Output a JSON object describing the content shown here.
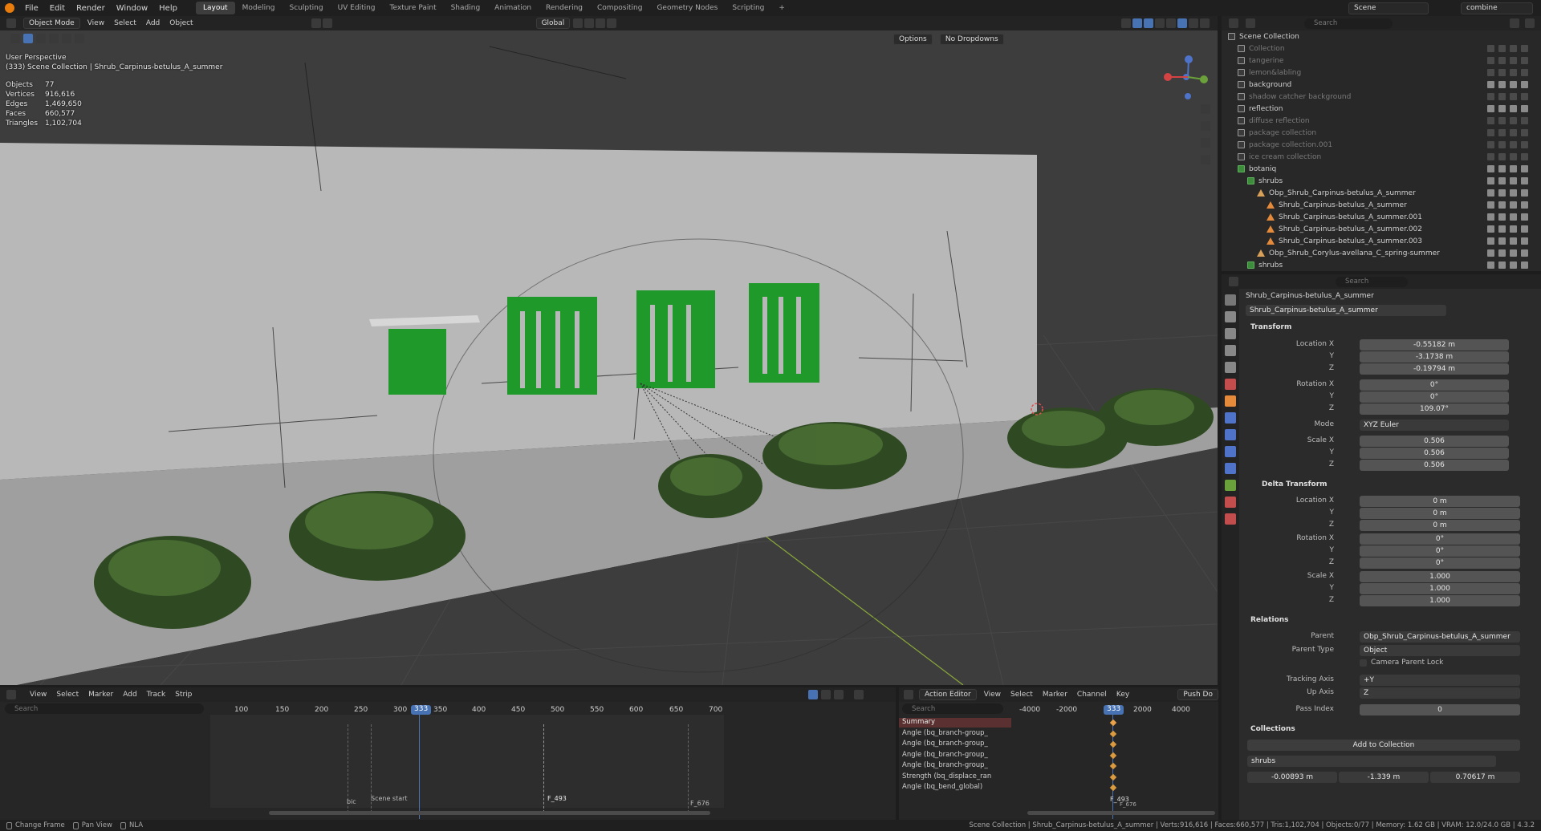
{
  "topbar": {
    "menus": [
      "File",
      "Edit",
      "Render",
      "Window",
      "Help"
    ],
    "workspaces": [
      "Layout",
      "Modeling",
      "Sculpting",
      "UV Editing",
      "Texture Paint",
      "Shading",
      "Animation",
      "Rendering",
      "Compositing",
      "Geometry Nodes",
      "Scripting"
    ],
    "active_workspace": "Layout",
    "scene": "Scene",
    "view_layer": "combine"
  },
  "viewport_header": {
    "mode": "Object Mode",
    "menus": [
      "View",
      "Select",
      "Add",
      "Object"
    ],
    "transform_orientation": "Global",
    "options": "Options",
    "overlay_dropdown": "No Dropdowns"
  },
  "viewport": {
    "view_name": "User Perspective",
    "context": "(333) Scene Collection | Shrub_Carpinus-betulus_A_summer",
    "stats": [
      {
        "label": "Objects",
        "value": "77"
      },
      {
        "label": "Vertices",
        "value": "916,616"
      },
      {
        "label": "Edges",
        "value": "1,469,650"
      },
      {
        "label": "Faces",
        "value": "660,577"
      },
      {
        "label": "Triangles",
        "value": "1,102,704"
      }
    ]
  },
  "outliner": {
    "search_placeholder": "Search",
    "root": "Scene Collection",
    "items": [
      {
        "label": "Collection",
        "dim": true
      },
      {
        "label": "tangerine",
        "dim": true
      },
      {
        "label": "lemon&labling",
        "dim": true
      },
      {
        "label": "background",
        "dim": false
      },
      {
        "label": "shadow catcher background",
        "dim": true
      },
      {
        "label": "reflection",
        "dim": false
      },
      {
        "label": "diffuse reflection",
        "dim": true
      },
      {
        "label": "package collection",
        "dim": true
      },
      {
        "label": "package collection.001",
        "dim": true
      },
      {
        "label": "ice cream collection",
        "dim": true
      },
      {
        "label": "botaniq",
        "dim": false
      },
      {
        "label": "shrubs",
        "dim": false
      },
      {
        "label": "Obp_Shrub_Carpinus-betulus_A_summer",
        "dim": false
      },
      {
        "label": "Shrub_Carpinus-betulus_A_summer",
        "dim": false
      },
      {
        "label": "Shrub_Carpinus-betulus_A_summer.001",
        "dim": false
      },
      {
        "label": "Shrub_Carpinus-betulus_A_summer.002",
        "dim": false
      },
      {
        "label": "Shrub_Carpinus-betulus_A_summer.003",
        "dim": false
      },
      {
        "label": "Obp_Shrub_Corylus-avellana_C_spring-summer",
        "dim": false
      },
      {
        "label": "shrubs",
        "dim": false
      }
    ]
  },
  "properties": {
    "search_placeholder": "Search",
    "object_name": "Shrub_Carpinus-betulus_A_summer",
    "object_field": "Shrub_Carpinus-betulus_A_summer",
    "transform": {
      "title": "Transform",
      "location_label": "Location X",
      "location": [
        "-0.55182 m",
        "-3.1738 m",
        "-0.19794 m"
      ],
      "rotation_label": "Rotation X",
      "rotation": [
        "0°",
        "0°",
        "109.07°"
      ],
      "mode_label": "Mode",
      "mode": "XYZ Euler",
      "scale_label": "Scale X",
      "scale": [
        "0.506",
        "0.506",
        "0.506"
      ]
    },
    "delta": {
      "title": "Delta Transform",
      "location": [
        "0 m",
        "0 m",
        "0 m"
      ],
      "rotation": [
        "0°",
        "0°",
        "0°"
      ],
      "scale": [
        "1.000",
        "1.000",
        "1.000"
      ]
    },
    "relations": {
      "title": "Relations",
      "parent_label": "Parent",
      "parent": "Obp_Shrub_Carpinus-betulus_A_summer",
      "parent_type_label": "Parent Type",
      "parent_type": "Object",
      "camera_lock": "Camera Parent Lock",
      "tracking_label": "Tracking Axis",
      "tracking": "+Y",
      "up_label": "Up Axis",
      "up": "Z",
      "pass_label": "Pass Index",
      "pass": "0"
    },
    "collections": {
      "title": "Collections",
      "add_button": "Add to Collection",
      "entry": "shrubs",
      "offset_x": "-0.00893 m",
      "offset_y": "-1.339 m",
      "offset_z": "0.70617 m"
    },
    "axis_y": "Y",
    "axis_z": "Z"
  },
  "timeline": {
    "menus": [
      "View",
      "Select",
      "Marker",
      "Add",
      "Track",
      "Strip"
    ],
    "search_placeholder": "Search",
    "frames": [
      "100",
      "150",
      "200",
      "250",
      "300",
      "350",
      "400",
      "450",
      "500",
      "550",
      "600",
      "650",
      "700"
    ],
    "current_frame": "333",
    "markers": [
      "bic",
      "Scene start",
      "F_493",
      "F_676"
    ]
  },
  "action_editor": {
    "mode": "Action Editor",
    "menus": [
      "View",
      "Select",
      "Marker",
      "Channel",
      "Key"
    ],
    "push_down": "Push Do",
    "search_placeholder": "Search",
    "frames": [
      "-4000",
      "-2000",
      "2000",
      "4000"
    ],
    "current_frame": "333",
    "channels": [
      "Summary",
      "Angle (bq_branch-group_",
      "Angle (bq_branch-group_",
      "Angle (bq_branch-group_",
      "Angle (bq_branch-group_",
      "Strength (bq_displace_ran",
      "Angle (bq_bend_global)"
    ],
    "marker": "F_493",
    "marker2": "F_676"
  },
  "statusbar": {
    "left": [
      "Change Frame",
      "Pan View",
      "NLA"
    ],
    "right": "Scene Collection | Shrub_Carpinus-betulus_A_summer | Verts:916,616 | Faces:660,577 | Tris:1,102,704 | Objects:0/77 | Memory: 1.62 GB | VRAM: 12.0/24.0 GB | 4.3.2"
  },
  "colors": {
    "accent": "#4772b3",
    "green_window": "#1f9a2a",
    "wall": "#bdbdbd",
    "panel": "#2b2b2b"
  }
}
